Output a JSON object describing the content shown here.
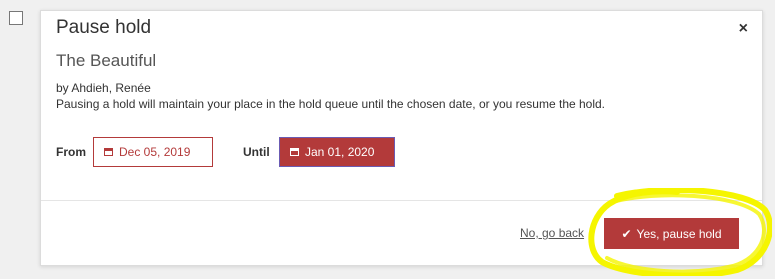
{
  "dialog": {
    "title": "Pause hold",
    "close_symbol": "×",
    "book_title": "The Beautiful",
    "author": "by Ahdieh, Renée",
    "description": "Pausing a hold will maintain your place in the hold queue until the chosen date, or you resume the hold."
  },
  "dates": {
    "from_label": "From",
    "from_value": "Dec 05, 2019",
    "until_label": "Until",
    "until_value": "Jan 01, 2020",
    "icon": "calendar-icon"
  },
  "footer": {
    "cancel_label": "No, go back",
    "confirm_label": "Yes, pause hold",
    "confirm_icon": "checkmark-icon"
  },
  "colors": {
    "accent": "#b33a3a",
    "highlight": "#f5f500",
    "background": "#f0f0f0"
  }
}
